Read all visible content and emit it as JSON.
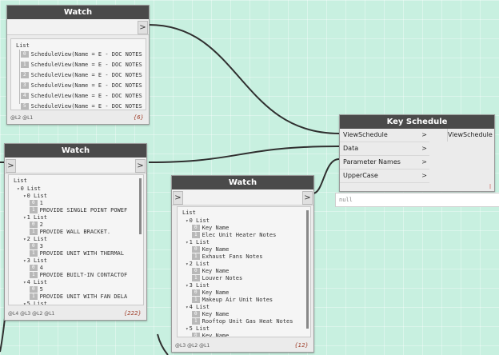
{
  "watch1": {
    "title": "Watch",
    "in_port": ">",
    "out_port": ">",
    "root": "List",
    "items": [
      {
        "idx": "0",
        "text": "ScheduleView(Name = E - DOC NOTES"
      },
      {
        "idx": "1",
        "text": "ScheduleView(Name = E - DOC NOTES"
      },
      {
        "idx": "2",
        "text": "ScheduleView(Name = E - DOC NOTES"
      },
      {
        "idx": "3",
        "text": "ScheduleView(Name = E - DOC NOTES"
      },
      {
        "idx": "4",
        "text": "ScheduleView(Name = E - DOC NOTES"
      },
      {
        "idx": "5",
        "text": "ScheduleView(Name = E - DOC NOTES"
      }
    ],
    "levels": "@L2 @L1",
    "count": "{6}"
  },
  "watch2": {
    "title": "Watch",
    "in_port": ">",
    "out_port": ">",
    "root": "List",
    "lines": [
      {
        "caret": "▾",
        "idx": "",
        "text": "0 List",
        "indent": 1
      },
      {
        "caret": "▾",
        "idx": "",
        "text": "0 List",
        "indent": 2
      },
      {
        "caret": "",
        "idx": "0",
        "text": "1",
        "indent": 3
      },
      {
        "caret": "",
        "idx": "1",
        "text": "PROVIDE SINGLE POINT POWEF",
        "indent": 3
      },
      {
        "caret": "▾",
        "idx": "",
        "text": "1 List",
        "indent": 2
      },
      {
        "caret": "",
        "idx": "0",
        "text": "2",
        "indent": 3
      },
      {
        "caret": "",
        "idx": "1",
        "text": "PROVIDE WALL BRACKET.",
        "indent": 3
      },
      {
        "caret": "▾",
        "idx": "",
        "text": "2 List",
        "indent": 2
      },
      {
        "caret": "",
        "idx": "0",
        "text": "3",
        "indent": 3
      },
      {
        "caret": "",
        "idx": "1",
        "text": "PROVIDE UNIT WITH THERMAL",
        "indent": 3
      },
      {
        "caret": "▾",
        "idx": "",
        "text": "3 List",
        "indent": 2
      },
      {
        "caret": "",
        "idx": "0",
        "text": "4",
        "indent": 3
      },
      {
        "caret": "",
        "idx": "1",
        "text": "PROVIDE BUILT-IN CONTACTOF",
        "indent": 3
      },
      {
        "caret": "▾",
        "idx": "",
        "text": "4 List",
        "indent": 2
      },
      {
        "caret": "",
        "idx": "0",
        "text": "5",
        "indent": 3
      },
      {
        "caret": "",
        "idx": "1",
        "text": "PROVIDE UNIT WITH FAN DELA",
        "indent": 3
      },
      {
        "caret": "▾",
        "idx": "",
        "text": "5 List",
        "indent": 2
      }
    ],
    "levels": "@L4 @L3 @L2 @L1",
    "count": "{222}"
  },
  "watch3": {
    "title": "Watch",
    "in_port": ">",
    "out_port": ">",
    "root": "List",
    "lines": [
      {
        "caret": "▾",
        "idx": "",
        "text": "0 List",
        "indent": 1
      },
      {
        "caret": "",
        "idx": "0",
        "text": "Key Name",
        "indent": 2
      },
      {
        "caret": "",
        "idx": "1",
        "text": "Elec Unit Heater Notes",
        "indent": 2
      },
      {
        "caret": "▾",
        "idx": "",
        "text": "1 List",
        "indent": 1
      },
      {
        "caret": "",
        "idx": "0",
        "text": "Key Name",
        "indent": 2
      },
      {
        "caret": "",
        "idx": "1",
        "text": "Exhaust Fans Notes",
        "indent": 2
      },
      {
        "caret": "▾",
        "idx": "",
        "text": "2 List",
        "indent": 1
      },
      {
        "caret": "",
        "idx": "0",
        "text": "Key Name",
        "indent": 2
      },
      {
        "caret": "",
        "idx": "1",
        "text": "Louver Notes",
        "indent": 2
      },
      {
        "caret": "▾",
        "idx": "",
        "text": "3 List",
        "indent": 1
      },
      {
        "caret": "",
        "idx": "0",
        "text": "Key Name",
        "indent": 2
      },
      {
        "caret": "",
        "idx": "1",
        "text": "Makeup Air Unit Notes",
        "indent": 2
      },
      {
        "caret": "▾",
        "idx": "",
        "text": "4 List",
        "indent": 1
      },
      {
        "caret": "",
        "idx": "0",
        "text": "Key Name",
        "indent": 2
      },
      {
        "caret": "",
        "idx": "1",
        "text": "Rooftop Unit Gas Heat Notes",
        "indent": 2
      },
      {
        "caret": "▾",
        "idx": "",
        "text": "5 List",
        "indent": 1
      },
      {
        "caret": "",
        "idx": "0",
        "text": "Key Name",
        "indent": 2
      }
    ],
    "levels": "@L3 @L2 @L1",
    "count": "{12}"
  },
  "key_schedule": {
    "title": "Key Schedule",
    "inputs": [
      "ViewSchedule",
      "Data",
      "Parameter Names",
      "UpperCase"
    ],
    "output": "ViewSchedule",
    "arrow": ">",
    "preview": "null"
  },
  "colors": {
    "canvas": "#c8f0e0",
    "title_bar": "#4a4a4a",
    "wire": "#2f2f2f",
    "count_text": "#a0402c"
  }
}
